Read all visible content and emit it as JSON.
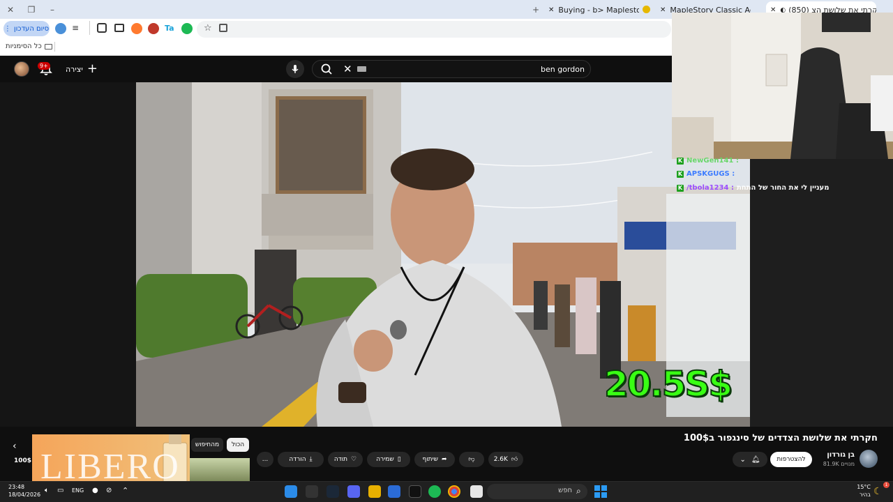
{
  "browser": {
    "tabs": [
      {
        "label": "(850) חקרתי את שלושת הצ..",
        "active": true
      },
      {
        "label": "MapleStory Classic Accounts - ..."
      },
      {
        "label": "Buying - b> Maplestory classic"
      }
    ],
    "finish_button": "סיום העדכון",
    "bookmarks_all": "כל הסימניות"
  },
  "youtube": {
    "notification_count": "9+",
    "create_label": "יצירה",
    "search_value": "ben gordon"
  },
  "video": {
    "price_overlay": "20.5S$",
    "title": "חקרתי את שלושת הצדדים של סינגפור ב100$",
    "channel_name": "בן גורדון",
    "subscribers": "81.9K מנויים",
    "join_label": "להצטרפות",
    "likes": "2.6K",
    "share_label": "שיתוף",
    "save_label": "שמירה",
    "thanks_label": "תודה",
    "download_label": "הורדה",
    "more_label": "..."
  },
  "recommendations": {
    "chip_all": "הכול",
    "chip_search": "מהחיפוש",
    "left_price": "100$",
    "ad_word": "LIBERO"
  },
  "chat": [
    {
      "user": "NewGen141 :",
      "color": "#6ad66a",
      "message": ""
    },
    {
      "user": "APSKGUGS :",
      "color": "#3b7bff",
      "message": ""
    },
    {
      "user": "/tbola1234 :",
      "color": "#9b4dff",
      "message": "מעניין לי את החור של התחת"
    }
  ],
  "taskbar": {
    "search_placeholder": "חפש",
    "lang": "ENG",
    "time": "23:48",
    "date": "18/04/2026",
    "temp": "15°C",
    "weather_label": "בהיר"
  },
  "colors": {
    "accent": "#39ff14",
    "yt_red": "#cc0000",
    "chrome_blue": "#0b57d0"
  }
}
